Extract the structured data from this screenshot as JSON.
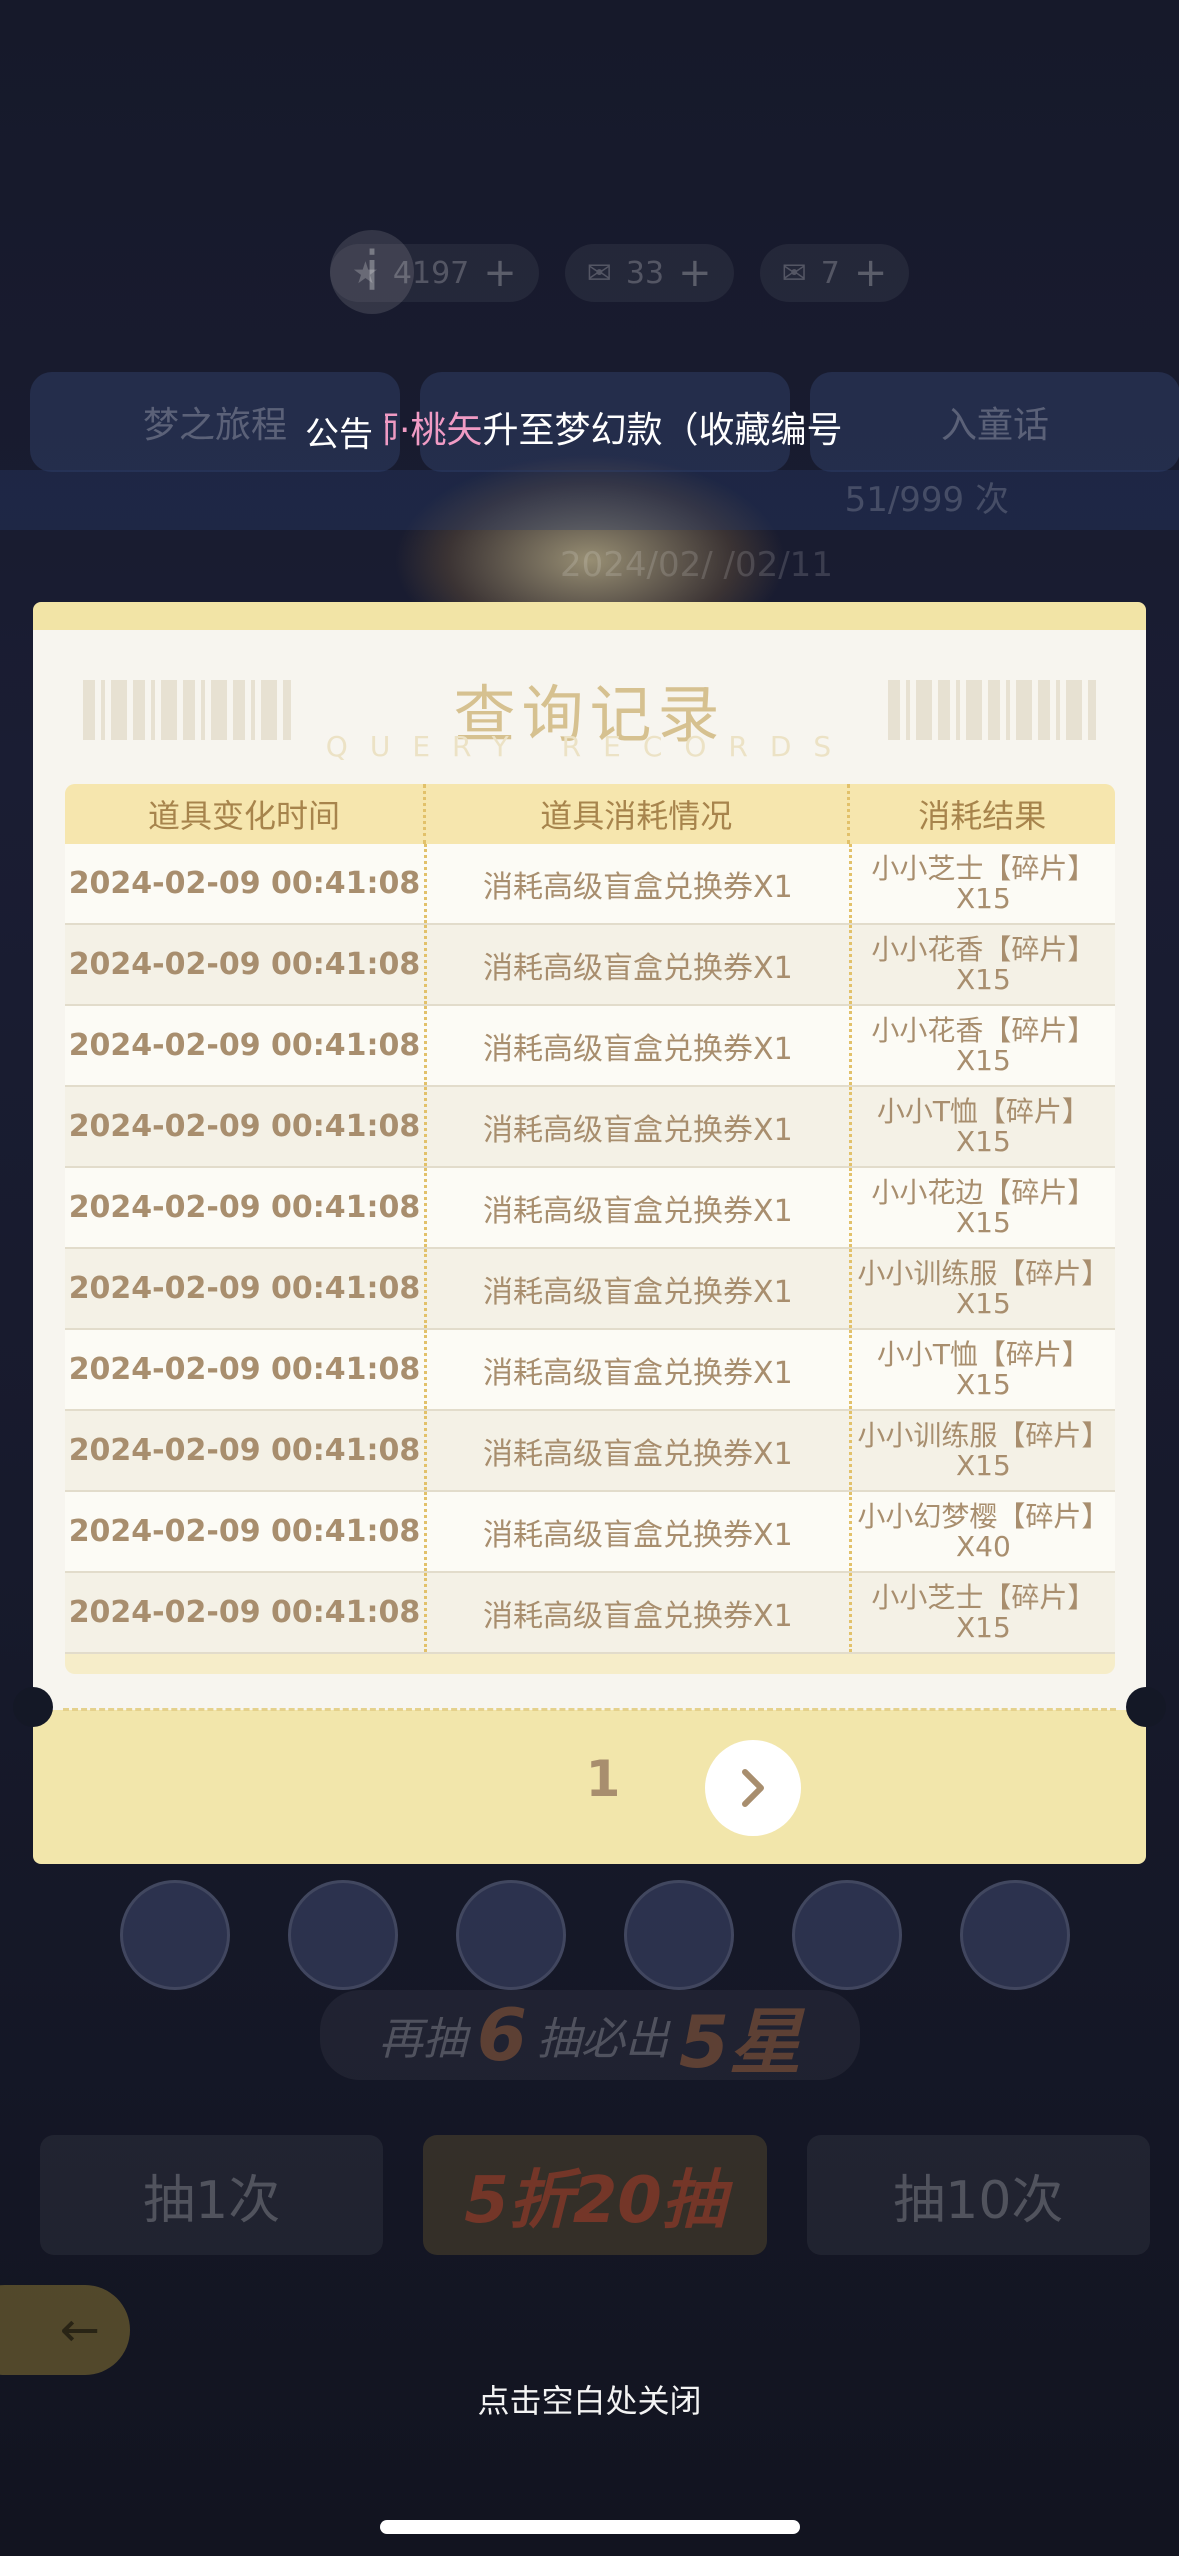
{
  "background": {
    "stats": [
      "4197",
      "33",
      "7"
    ],
    "tabs": [
      "梦之旅程",
      "",
      "入童话"
    ],
    "draw_count": "51/999 次",
    "dates": "2024/02/                /02/11",
    "guarantee": {
      "pre": "再抽",
      "num": "6",
      "post": "抽必出",
      "star": "5星"
    },
    "draw_buttons": [
      "抽1次",
      "5折20抽",
      "抽10次"
    ]
  },
  "announcement": {
    "label": "公告",
    "highlight": "师·桃矢",
    "text": "升至梦幻款（收藏编号"
  },
  "modal": {
    "title": "查询记录",
    "subtitle": "QUERY RECORDS",
    "columns": [
      "道具变化时间",
      "道具消耗情况",
      "消耗结果"
    ],
    "rows": [
      {
        "time": "2024-02-09 00:41:08",
        "consumption": "消耗高级盲盒兑换券X1",
        "result": "小小芝士【碎片】X15"
      },
      {
        "time": "2024-02-09 00:41:08",
        "consumption": "消耗高级盲盒兑换券X1",
        "result": "小小花香【碎片】X15"
      },
      {
        "time": "2024-02-09 00:41:08",
        "consumption": "消耗高级盲盒兑换券X1",
        "result": "小小花香【碎片】X15"
      },
      {
        "time": "2024-02-09 00:41:08",
        "consumption": "消耗高级盲盒兑换券X1",
        "result": "小小T恤【碎片】X15"
      },
      {
        "time": "2024-02-09 00:41:08",
        "consumption": "消耗高级盲盒兑换券X1",
        "result": "小小花边【碎片】X15"
      },
      {
        "time": "2024-02-09 00:41:08",
        "consumption": "消耗高级盲盒兑换券X1",
        "result": "小小训练服【碎片】X15"
      },
      {
        "time": "2024-02-09 00:41:08",
        "consumption": "消耗高级盲盒兑换券X1",
        "result": "小小T恤【碎片】X15"
      },
      {
        "time": "2024-02-09 00:41:08",
        "consumption": "消耗高级盲盒兑换券X1",
        "result": "小小训练服【碎片】X15"
      },
      {
        "time": "2024-02-09 00:41:08",
        "consumption": "消耗高级盲盒兑换券X1",
        "result": "小小幻梦樱【碎片】X40"
      },
      {
        "time": "2024-02-09 00:41:08",
        "consumption": "消耗高级盲盒兑换券X1",
        "result": "小小芝士【碎片】X15"
      }
    ],
    "page": "1"
  },
  "close_hint": "点击空白处关闭"
}
